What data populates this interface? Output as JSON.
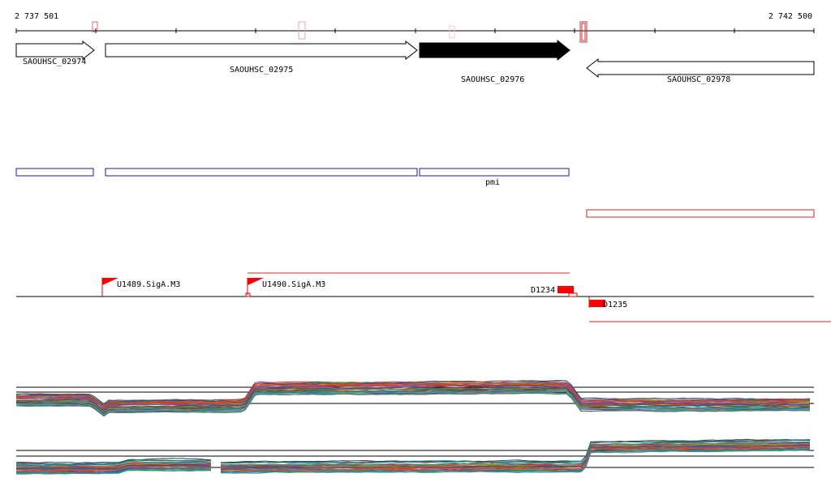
{
  "coordinates": {
    "start": "2 737 501",
    "end": "2 742 500"
  },
  "genes": [
    {
      "label": "SAOUHSC_02974",
      "strand": "+",
      "highlighted": false
    },
    {
      "label": "SAOUHSC_02975",
      "strand": "+",
      "highlighted": false
    },
    {
      "label": "SAOUHSC_02976",
      "strand": "+",
      "highlighted": true
    },
    {
      "label": "SAOUHSC_02978",
      "strand": "-",
      "highlighted": false
    }
  ],
  "operon_label": "pmi",
  "promoters": [
    {
      "label": "U1489.SigA.M3"
    },
    {
      "label": "U1490.SigA.M3"
    }
  ],
  "terminators": [
    {
      "label": "D1234"
    },
    {
      "label": "D1235"
    }
  ],
  "colors": {
    "gene_filled": "#000000",
    "operon_box": "#1a1aa0",
    "antisense_box": "#e02020",
    "feature_red": "#ff0000",
    "axis": "#000000"
  }
}
